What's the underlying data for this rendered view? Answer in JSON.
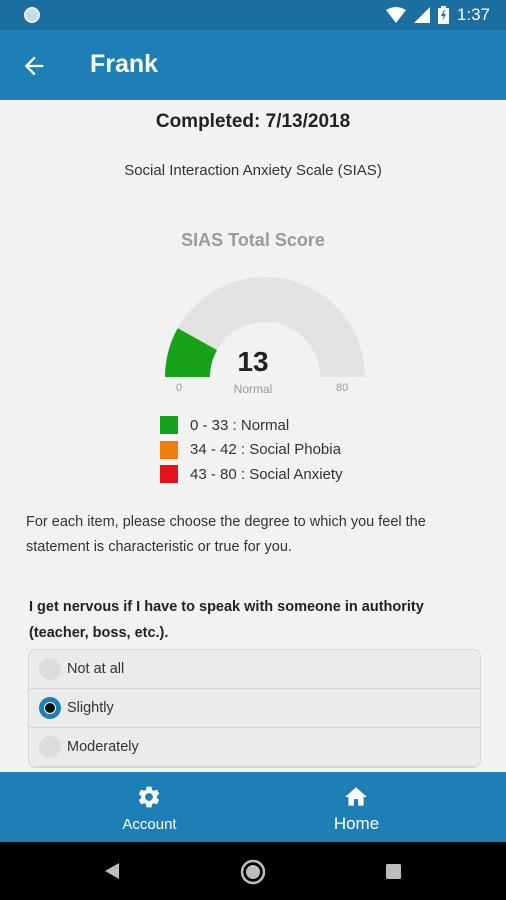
{
  "status_bar": {
    "time": "1:37"
  },
  "app_bar": {
    "title": "Frank",
    "back_icon": "arrow-left-icon"
  },
  "report": {
    "completed": "Completed: 7/13/2018",
    "scale_name": "Social Interaction Anxiety Scale (SIAS)"
  },
  "gauge": {
    "title": "SIAS Total Score",
    "score": "13",
    "label": "Normal",
    "min": "0",
    "max": "80",
    "value": 13,
    "range": [
      0,
      80
    ],
    "fill_color": "#16a31a",
    "track_color": "#e3e3e3"
  },
  "legend": [
    {
      "text": "0 - 33 : Normal",
      "color": "#16a31a"
    },
    {
      "text": "34 - 42 : Social Phobia",
      "color": "#f07d0b"
    },
    {
      "text": "43 - 80 : Social Anxiety",
      "color": "#e5141a"
    }
  ],
  "instructions": "For each item, please choose the degree to which you feel the statement is characteristic or true for you.",
  "question": {
    "text": "I get nervous if I have to speak with someone in authority (teacher, boss, etc.).",
    "options": [
      {
        "label": "Not at all",
        "selected": false
      },
      {
        "label": "Slightly",
        "selected": true
      },
      {
        "label": "Moderately",
        "selected": false
      }
    ]
  },
  "bottom_nav": {
    "account_label": "Account",
    "account_icon": "gear-icon",
    "home_label": "Home",
    "home_icon": "home-icon",
    "active": "home"
  },
  "colors": {
    "primary": "#1e7fb6",
    "status_bar": "#1a6fa0"
  }
}
